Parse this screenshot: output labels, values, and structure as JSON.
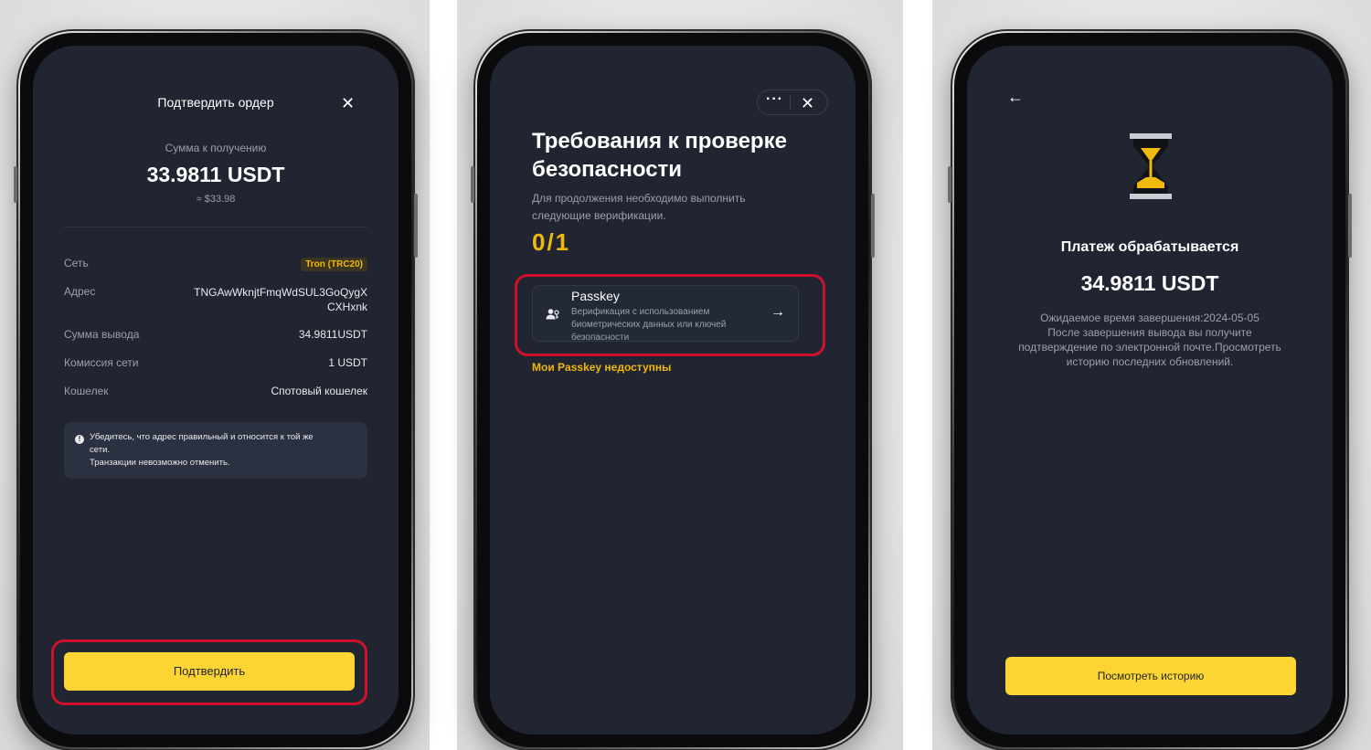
{
  "colors": {
    "accent": "#fcd535",
    "screen_bg": "#202531",
    "highlight_ring": "#d0112b"
  },
  "screen1": {
    "title": "Подтвердить ордер",
    "close_icon": "close-icon",
    "receive_label": "Сумма к получению",
    "receive_amount": "33.9811 USDT",
    "receive_approx": "≈ $33.98",
    "rows": [
      {
        "label": "Сеть",
        "value": "Tron (TRC20)"
      },
      {
        "label": "Адрес",
        "value_line1": "TNGAwWknjtFmqWdSUL3GoQygX",
        "value_line2": "CXHxnk"
      },
      {
        "label": "Сумма вывода",
        "value": "34.9811USDT"
      },
      {
        "label": "Комиссия сети",
        "value": "1 USDT"
      },
      {
        "label": "Кошелек",
        "value": "Спотовый кошелек"
      }
    ],
    "warning_line1": "Убедитесь, что адрес правильный и относится к той же",
    "warning_line2": "сети.",
    "warning_line3": "Транзакции невозможно отменить.",
    "confirm_button": "Подтвердить"
  },
  "screen2": {
    "more_icon": "···",
    "close_icon": "close-icon",
    "title_line1": "Требования к проверке",
    "title_line2": "безопасности",
    "desc_line1": "Для продолжения необходимо выполнить",
    "desc_line2": "следующие верификации.",
    "progress": "0/1",
    "passkey_title": "Passkey",
    "passkey_desc_line1": "Верификация с использованием",
    "passkey_desc_line2": "биометрических данных или ключей",
    "passkey_desc_line3": "безопасности",
    "unavailable_link": "Мои Passkey недоступны"
  },
  "screen3": {
    "back_icon": "back-arrow-icon",
    "status_icon": "hourglass-icon",
    "heading": "Платеж обрабатывается",
    "amount": "34.9811 USDT",
    "note_line1": "Ожидаемое время завершения:2024-05-05",
    "note_line2": "После завершения вывода вы получите",
    "note_line3": "подтверждение по электронной почте.Просмотреть",
    "note_line4": "историю последних обновлений.",
    "history_button": "Посмотреть историю"
  }
}
